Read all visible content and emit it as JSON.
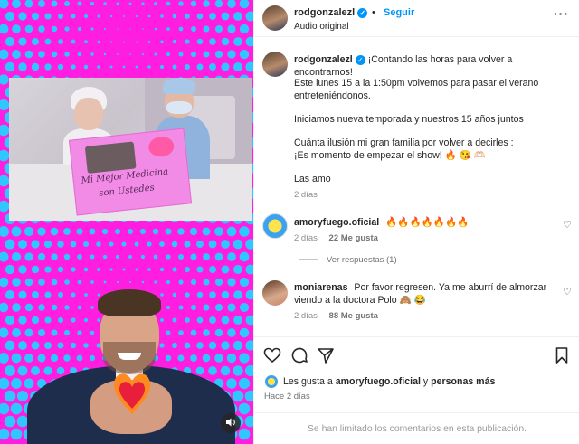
{
  "post": {
    "author": "rodgonzalezl",
    "follow_label": "Seguir",
    "dot": "•",
    "audio": "Audio original",
    "more": "···"
  },
  "caption": {
    "username": "rodgonzalezl",
    "line1": "¡Contando las horas para volver a encontrarnos!",
    "line2a": "Este lunes 15 a la 1:50pm volvemos para pasar el verano",
    "line2b": "entreteniéndonos.",
    "line3": "Iniciamos nueva temporada y nuestros 15 años juntos",
    "line4a": "Cuánta ilusión mi gran familia por volver a decirles :",
    "line4b": "¡Es momento de empezar el show! 🔥 😘 🫶🏻",
    "line5": "Las amo",
    "time": "2 días"
  },
  "comments": [
    {
      "username": "amoryfuego.oficial",
      "text": "🔥🔥🔥🔥🔥🔥🔥",
      "time": "2 días",
      "likes": "22 Me gusta",
      "replies": "Ver respuestas (1)"
    },
    {
      "username": "moniarenas",
      "text_a": "Por favor regresen. Ya me aburrí de almorzar",
      "text_b": "viendo a la doctora Polo 🙈 😂",
      "time": "2 días",
      "likes": "88 Me gusta"
    }
  ],
  "likes": {
    "prefix": "Les gusta a",
    "user": "amoryfuego.oficial",
    "mid": "y",
    "others": "personas más"
  },
  "ago": "Hace 2 días",
  "limited": "Se han limitado los comentarios en esta publicación.",
  "media": {
    "sign_text_1": "Mi Mejor Medicina",
    "sign_text_2": "son Ustedes"
  },
  "colors": {
    "accent": "#0095f6",
    "pink": "#ff1ee0",
    "dots": "#2ec8ff"
  }
}
